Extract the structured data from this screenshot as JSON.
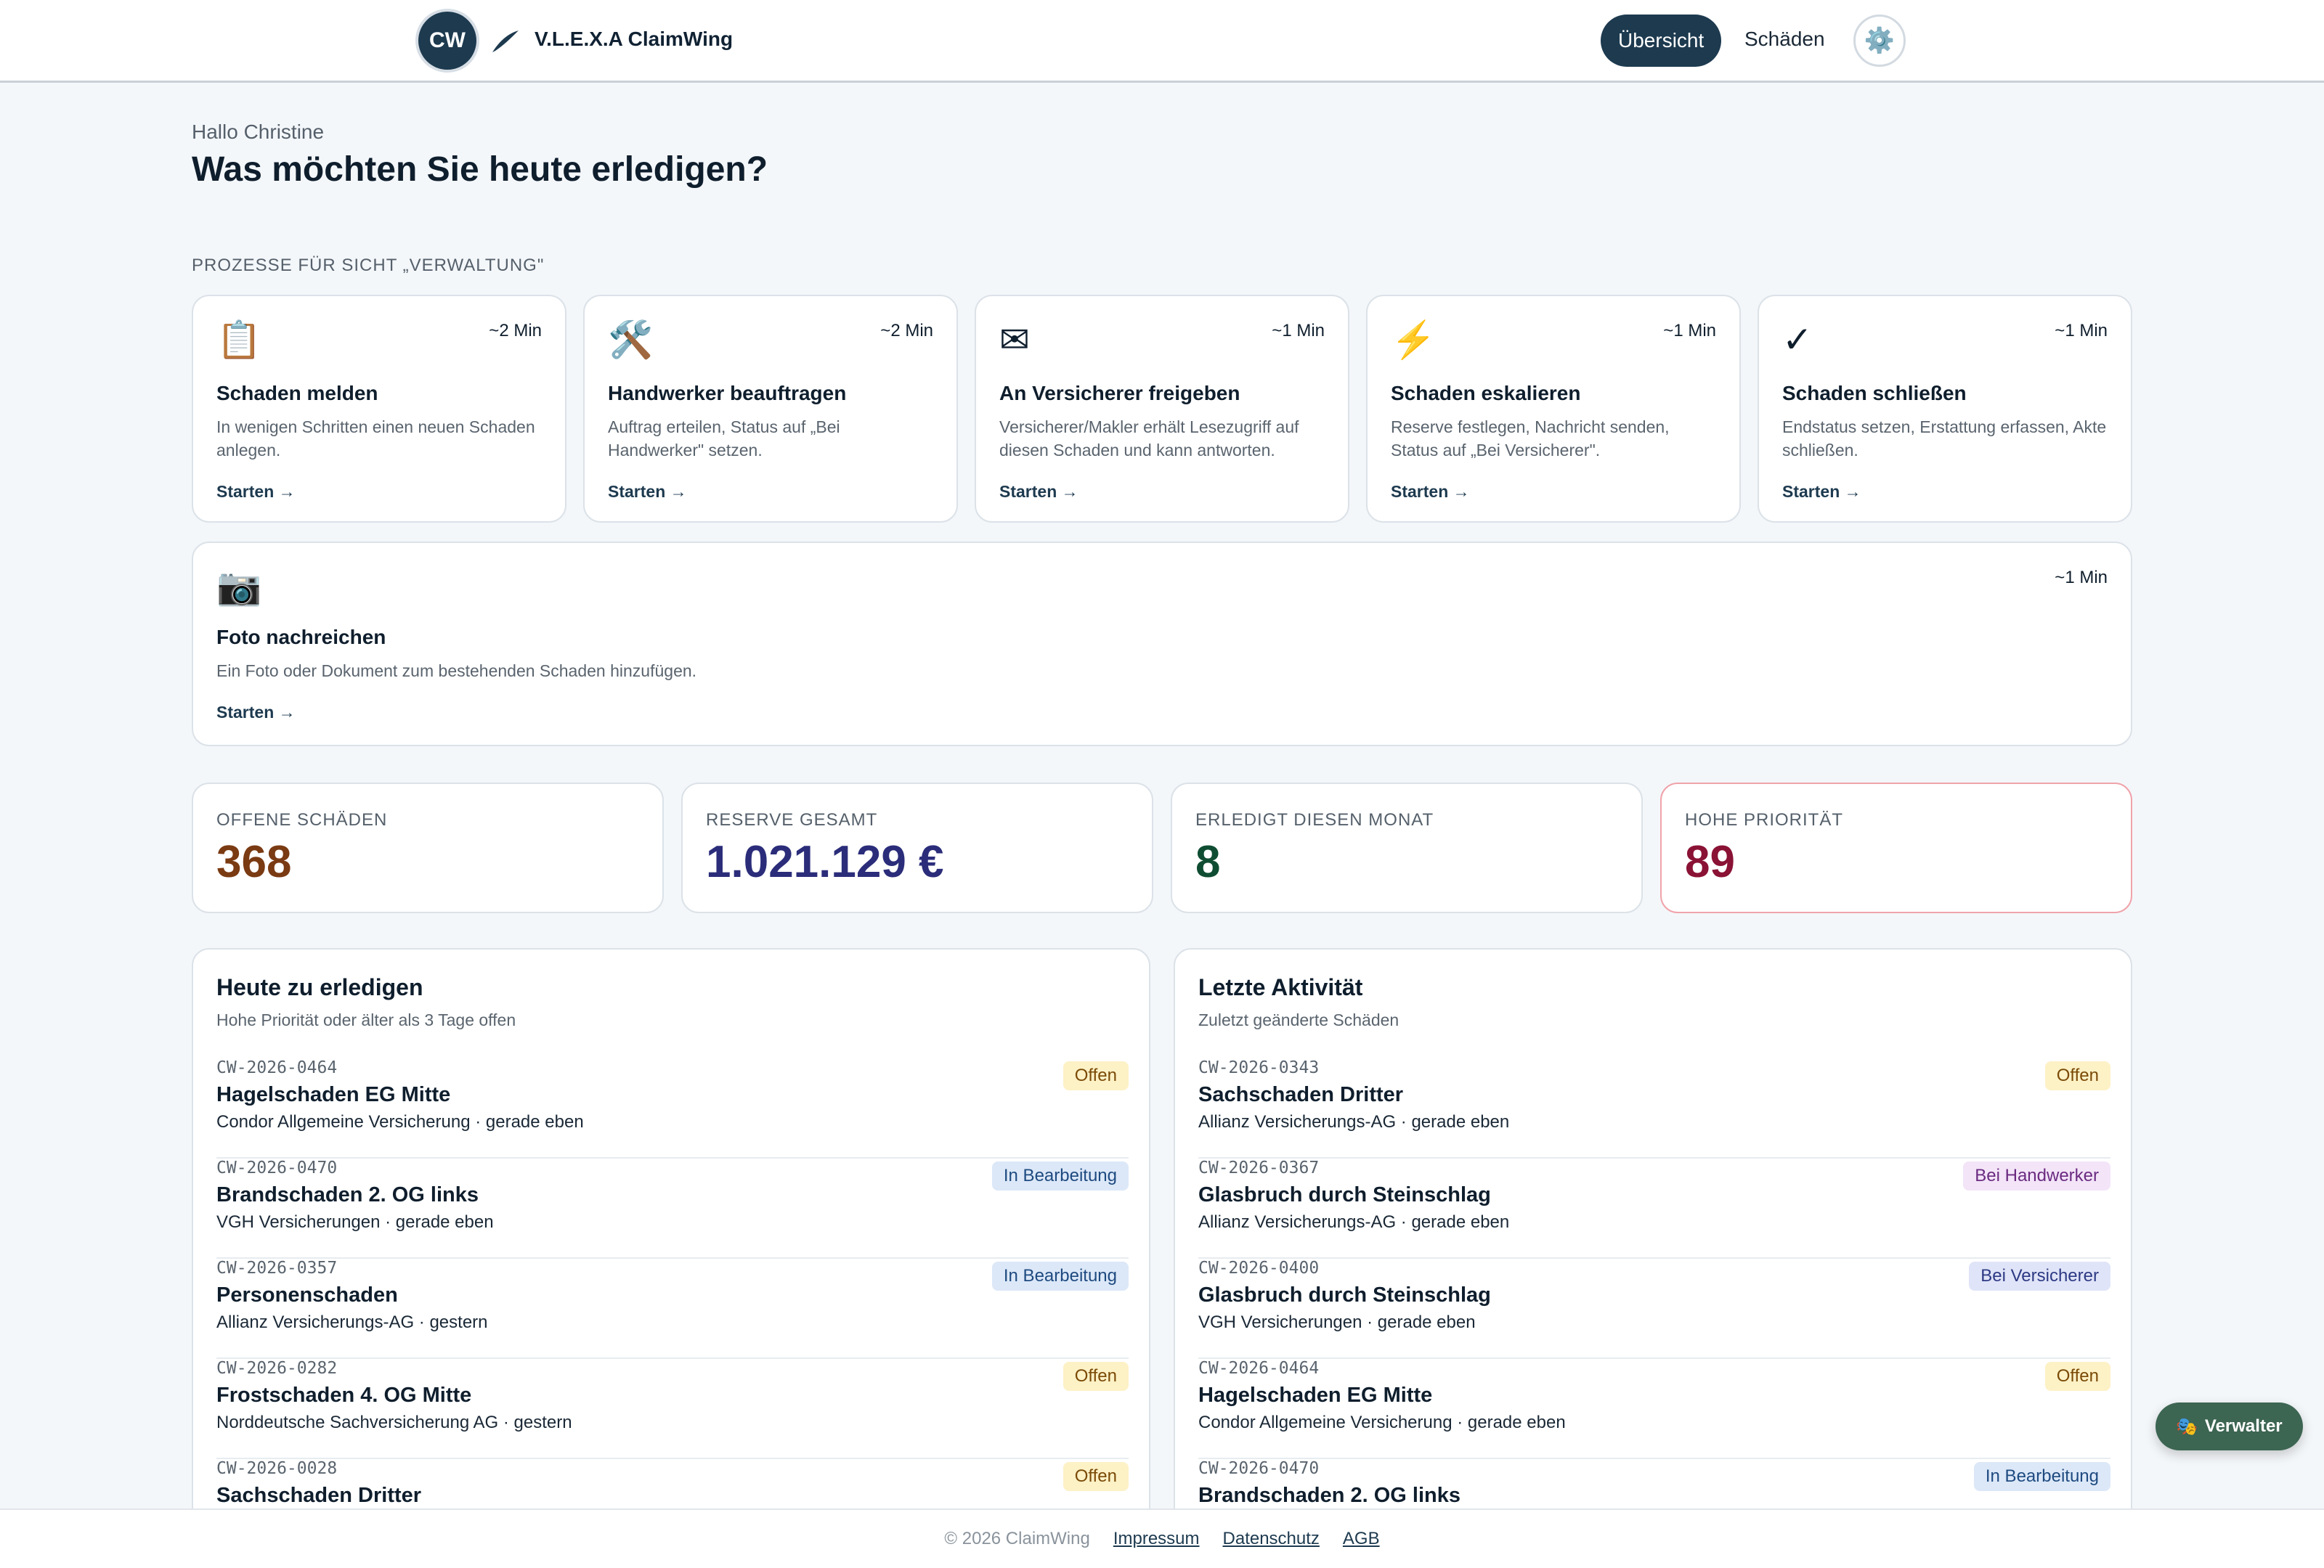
{
  "header": {
    "logo_initials": "CW",
    "brand": "V.L.E.X.A ClaimWing",
    "nav_active": "Übersicht",
    "nav_link": "Schäden",
    "settings_icon": "⚙️"
  },
  "greeting": {
    "hello": "Hallo Christine",
    "headline": "Was möchten Sie heute erledigen?"
  },
  "processes": {
    "section_label": "PROZESSE FÜR SICHT „VERWALTUNG\"",
    "cards": [
      {
        "icon": "📋",
        "duration": "~2 Min",
        "title": "Schaden melden",
        "desc": "In wenigen Schritten einen neuen Schaden anlegen.",
        "action": "Starten →"
      },
      {
        "icon": "🛠️",
        "duration": "~2 Min",
        "title": "Handwerker beauftragen",
        "desc": "Auftrag erteilen, Status auf „Bei Handwerker\" setzen.",
        "action": "Starten →"
      },
      {
        "icon": "✉",
        "duration": "~1 Min",
        "title": "An Versicherer freigeben",
        "desc": "Versicherer/Makler erhält Lesezugriff auf diesen Schaden und kann antworten.",
        "action": "Starten →"
      },
      {
        "icon": "⚡",
        "duration": "~1 Min",
        "title": "Schaden eskalieren",
        "desc": "Reserve festlegen, Nachricht senden, Status auf „Bei Versicherer\".",
        "action": "Starten →"
      },
      {
        "icon": "✓",
        "duration": "~1 Min",
        "title": "Schaden schließen",
        "desc": "Endstatus setzen, Erstattung erfassen, Akte schließen.",
        "action": "Starten →"
      }
    ],
    "wide_card": {
      "icon": "📷",
      "duration": "~1 Min",
      "title": "Foto nachreichen",
      "desc": "Ein Foto oder Dokument zum bestehenden Schaden hinzufügen.",
      "action": "Starten →"
    }
  },
  "kpis": [
    {
      "label": "OFFENE SCHÄDEN",
      "value": "368",
      "color": "#7a3a12"
    },
    {
      "label": "RESERVE GESAMT",
      "value": "1.021.129 €",
      "color": "#2b2d7a"
    },
    {
      "label": "ERLEDIGT DIESEN MONAT",
      "value": "8",
      "color": "#0f4d33"
    },
    {
      "label": "HOHE PRIORITÄT",
      "value": "89",
      "color": "#8a1235"
    }
  ],
  "today": {
    "title": "Heute zu erledigen",
    "subtitle": "Hohe Priorität oder älter als 3 Tage offen",
    "rows": [
      {
        "id": "CW-2026-0464",
        "title": "Hagelschaden EG Mitte",
        "meta": "Condor Allgemeine Versicherung · gerade eben",
        "status": "Offen",
        "kind": "offen"
      },
      {
        "id": "CW-2026-0470",
        "title": "Brandschaden 2. OG links",
        "meta": "VGH Versicherungen · gerade eben",
        "status": "In Bearbeitung",
        "kind": "bearbeitung"
      },
      {
        "id": "CW-2026-0357",
        "title": "Personenschaden",
        "meta": "Allianz Versicherungs-AG · gestern",
        "status": "In Bearbeitung",
        "kind": "bearbeitung"
      },
      {
        "id": "CW-2026-0282",
        "title": "Frostschaden 4. OG Mitte",
        "meta": "Norddeutsche Sachversicherung AG · gestern",
        "status": "Offen",
        "kind": "offen"
      },
      {
        "id": "CW-2026-0028",
        "title": "Sachschaden Dritter",
        "meta": "",
        "status": "Offen",
        "kind": "offen"
      }
    ]
  },
  "activity": {
    "title": "Letzte Aktivität",
    "subtitle": "Zuletzt geänderte Schäden",
    "rows": [
      {
        "id": "CW-2026-0343",
        "title": "Sachschaden Dritter",
        "meta": "Allianz Versicherungs-AG · gerade eben",
        "status": "Offen",
        "kind": "offen"
      },
      {
        "id": "CW-2026-0367",
        "title": "Glasbruch durch Steinschlag",
        "meta": "Allianz Versicherungs-AG · gerade eben",
        "status": "Bei Handwerker",
        "kind": "handwerker"
      },
      {
        "id": "CW-2026-0400",
        "title": "Glasbruch durch Steinschlag",
        "meta": "VGH Versicherungen · gerade eben",
        "status": "Bei Versicherer",
        "kind": "versicherer"
      },
      {
        "id": "CW-2026-0464",
        "title": "Hagelschaden EG Mitte",
        "meta": "Condor Allgemeine Versicherung · gerade eben",
        "status": "Offen",
        "kind": "offen"
      },
      {
        "id": "CW-2026-0470",
        "title": "Brandschaden 2. OG links",
        "meta": "",
        "status": "In Bearbeitung",
        "kind": "bearbeitung"
      }
    ]
  },
  "footer": {
    "copyright": "© 2026 ClaimWing",
    "links": [
      "Impressum",
      "Datenschutz",
      "AGB"
    ]
  },
  "role_button": {
    "icon": "🎭",
    "label": "Verwalter"
  }
}
